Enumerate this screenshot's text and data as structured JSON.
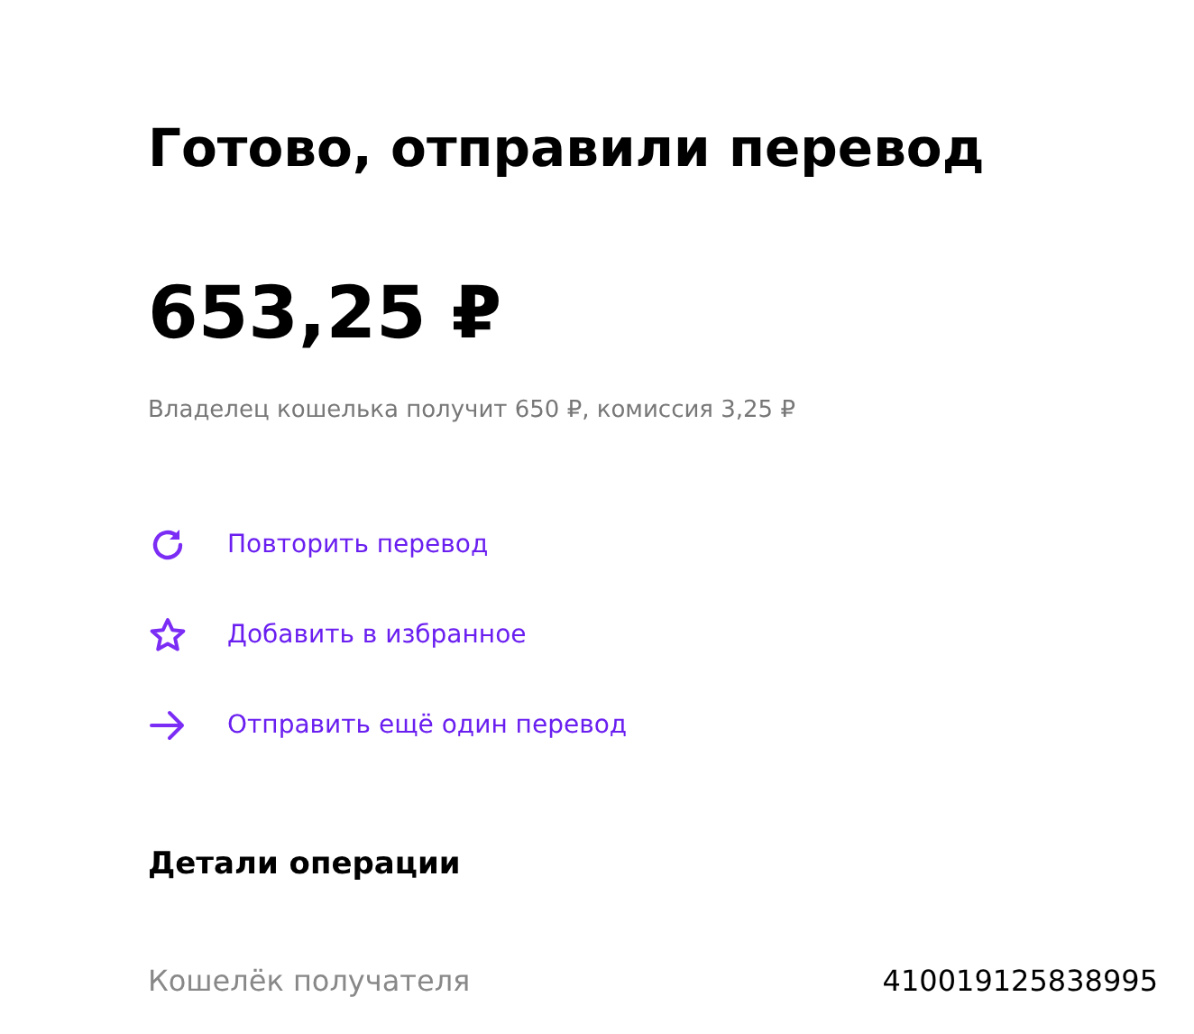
{
  "title": "Готово, отправили перевод",
  "amount": "653,25 ₽",
  "summary": "Владелец кошелька получит 650 ₽, комиссия 3,25 ₽",
  "actions": [
    {
      "kind": "repeat",
      "label": "Повторить перевод"
    },
    {
      "kind": "favorite",
      "label": "Добавить в избранное"
    },
    {
      "kind": "send",
      "label": "Отправить ещё один перевод"
    }
  ],
  "details": {
    "heading": "Детали операции",
    "rows": [
      {
        "label": "Кошелёк получателя",
        "value": "410019125838995"
      }
    ]
  }
}
